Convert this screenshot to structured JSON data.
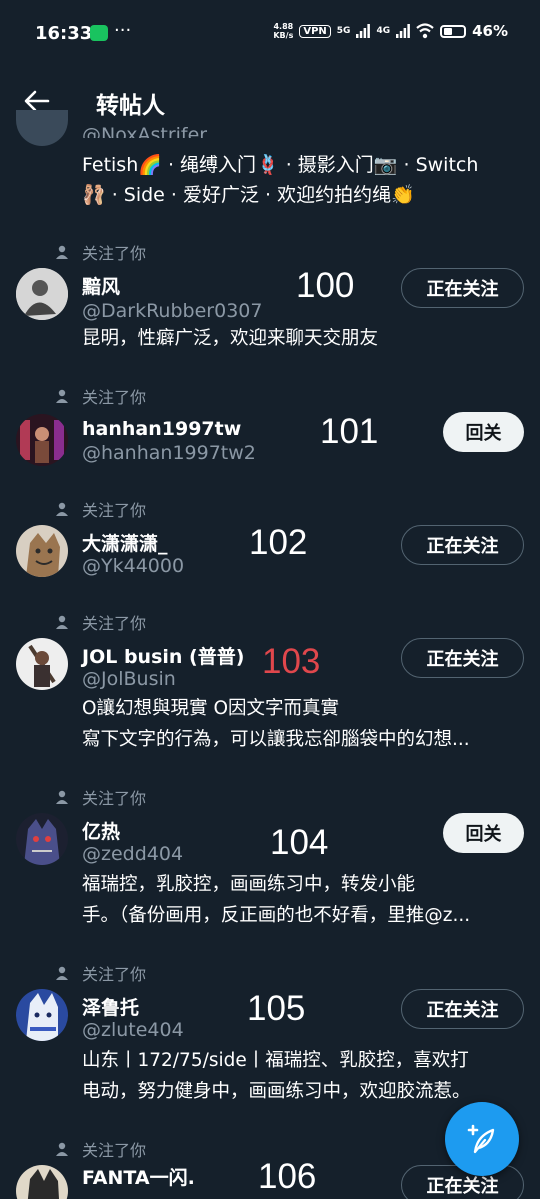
{
  "status_bar": {
    "time": "16:33",
    "speed_value": "4.88",
    "speed_unit": "KB/s",
    "vpn": "VPN",
    "net1": "5G",
    "net2": "4G",
    "battery": "46%"
  },
  "header": {
    "title": "转帖人"
  },
  "partial_item": {
    "handle": "@NoxAstrifer",
    "bio_line1": "Fetish🌈 · 绳缚入门🪢 · 摄影入门📷 · Switch",
    "bio_line2": "🩰 · Side · 爱好广泛 · 欢迎约拍约绳👏"
  },
  "follows_you_label": "关注了你",
  "items": [
    {
      "name": "黯风",
      "handle": "@DarkRubber0307",
      "number": "100",
      "number_color": "#ffffff",
      "button": "正在关注",
      "bio": [
        "昆明，性癖广泛，欢迎来聊天交朋友"
      ]
    },
    {
      "name": "hanhan1997tw",
      "handle": "@hanhan1997tw2",
      "number": "101",
      "number_color": "#ffffff",
      "button": "回关",
      "bio": []
    },
    {
      "name": "大潇潇潇_",
      "handle": "@Yk44000",
      "number": "102",
      "number_color": "#ffffff",
      "button": "正在关注",
      "bio": []
    },
    {
      "name": "JOL busin (普普)",
      "handle": "@JolBusin",
      "number": "103",
      "number_color": "#e0474c",
      "button": "正在关注",
      "bio": [
        "O讓幻想與現實 O因文字而真實",
        "寫下文字的行為，可以讓我忘卻腦袋中的幻想..."
      ]
    },
    {
      "name": "亿热",
      "handle": "@zedd404",
      "number": "104",
      "number_color": "#ffffff",
      "button": "回关",
      "bio": [
        "福瑞控，乳胶控，画画练习中，转发小能",
        "手。（备份画用，反正画的也不好看，里推@z..."
      ]
    },
    {
      "name": "泽鲁托",
      "handle": "@zlute404",
      "number": "105",
      "number_color": "#ffffff",
      "button": "正在关注",
      "bio": [
        "山东丨172/75/side丨福瑞控、乳胶控，喜欢打",
        "电动，努力健身中，画画练习中，欢迎胶流惹。"
      ]
    },
    {
      "name": "FANTA一闪.",
      "handle": "",
      "number": "106",
      "number_color": "#ffffff",
      "button": "正在关注",
      "bio": []
    }
  ],
  "colors": {
    "background": "#15202b",
    "accent": "#1d9bf0",
    "secondary_text": "#8b98a5",
    "highlight_number": "#e0474c"
  }
}
